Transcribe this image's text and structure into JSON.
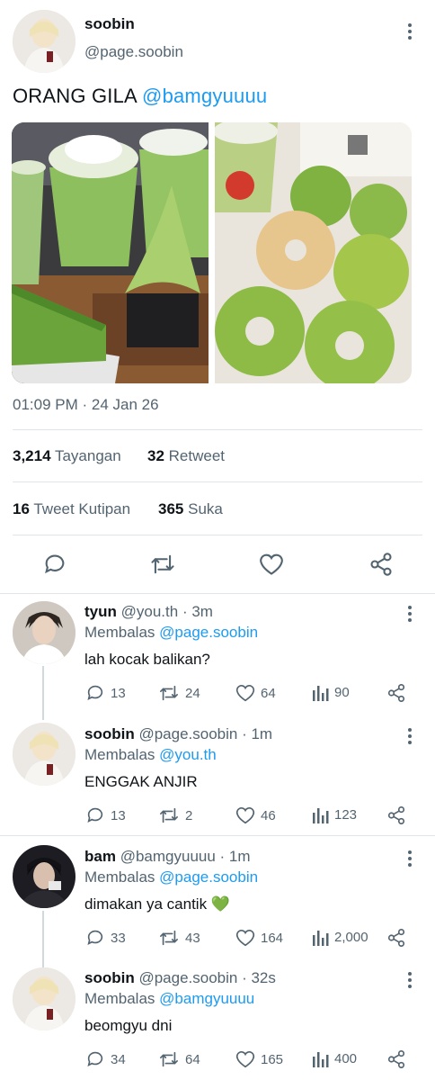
{
  "tweet": {
    "author_name": "soobin",
    "author_handle": "@page.soobin",
    "text_prefix": "ORANG GILA ",
    "text_mention": "@bamgyuuuu",
    "timestamp": "01:09 PM · 24 Jan 26",
    "views_count": "3,214",
    "views_label": "Tayangan",
    "retweets_count": "32",
    "retweets_label": "Retweet",
    "quotes_count": "16",
    "quotes_label": "Tweet Kutipan",
    "likes_count": "365",
    "likes_label": "Suka"
  },
  "replies": [
    {
      "name": "tyun",
      "handle": "@you.th",
      "time": "· 3m",
      "replying_label": "Membalas",
      "replying_to": "@page.soobin",
      "text": "lah kocak balikan?",
      "replies": "13",
      "retweets": "24",
      "likes": "64",
      "views": "90"
    },
    {
      "name": "soobin",
      "handle": "@page.soobin",
      "time": "· 1m",
      "replying_label": "Membalas",
      "replying_to": "@you.th",
      "text": "ENGGAK ANJIR",
      "replies": "13",
      "retweets": "2",
      "likes": "46",
      "views": "123"
    },
    {
      "name": "bam",
      "handle": "@bamgyuuuu",
      "time": "· 1m",
      "replying_label": "Membalas",
      "replying_to": "@page.soobin",
      "text": "dimakan ya cantik 💚",
      "replies": "33",
      "retweets": "43",
      "likes": "164",
      "views": "2,000"
    },
    {
      "name": "soobin",
      "handle": "@page.soobin",
      "time": "· 32s",
      "replying_label": "Membalas",
      "replying_to": "@bamgyuuuu",
      "text": "beomgyu dni",
      "replies": "34",
      "retweets": "64",
      "likes": "165",
      "views": "400"
    }
  ],
  "colors": {
    "accent": "#1d9bf0",
    "muted": "#536471",
    "matcha": "#7fb241"
  }
}
